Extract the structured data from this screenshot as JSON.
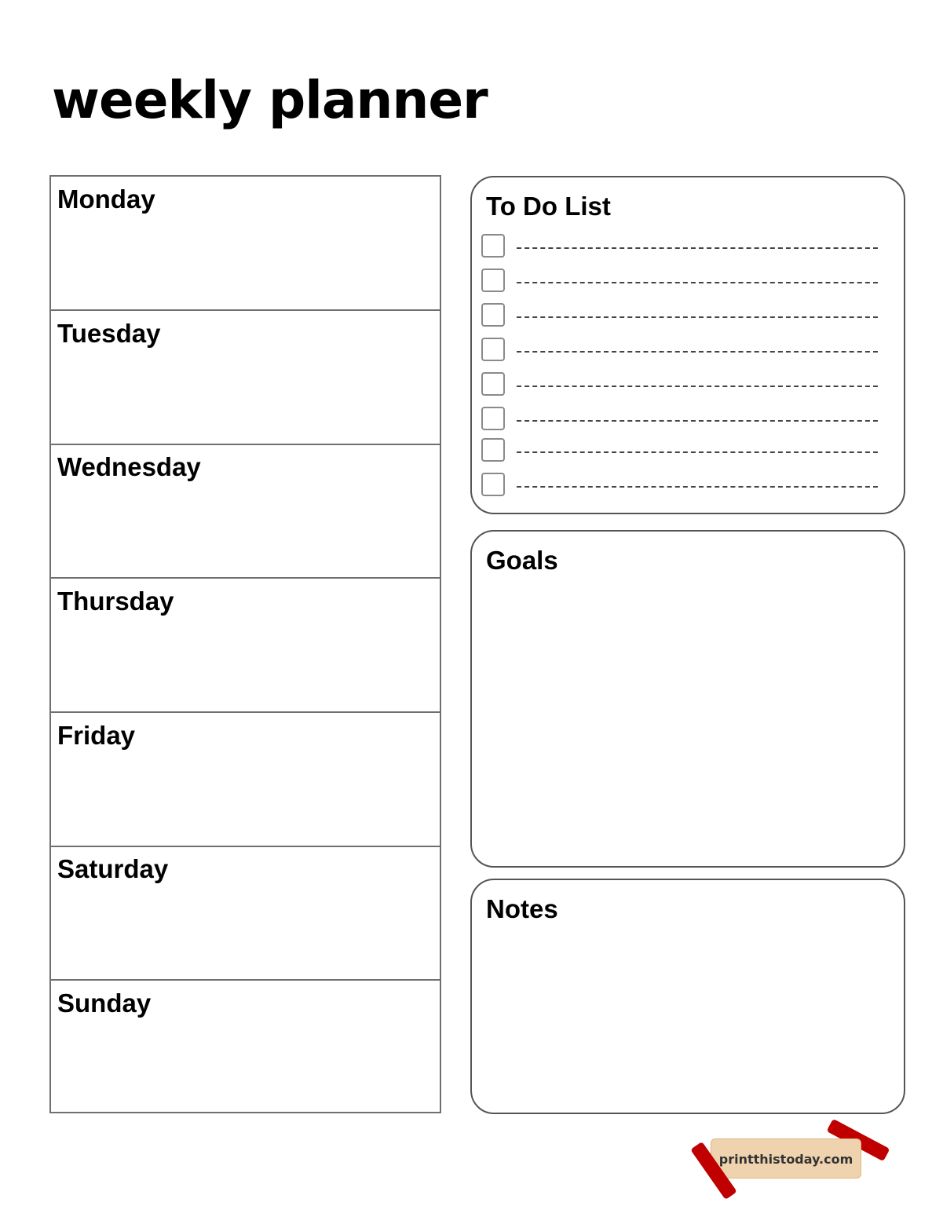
{
  "title": "Weekly Planner",
  "days": [
    {
      "label": "Monday"
    },
    {
      "label": "Tuesday"
    },
    {
      "label": "Wednesday"
    },
    {
      "label": "Thursday"
    },
    {
      "label": "Friday"
    },
    {
      "label": "Saturday"
    },
    {
      "label": "Sunday"
    }
  ],
  "todo": {
    "title": "To Do List",
    "items": [
      {
        "text": "",
        "checked": false
      },
      {
        "text": "",
        "checked": false
      },
      {
        "text": "",
        "checked": false
      },
      {
        "text": "",
        "checked": false
      },
      {
        "text": "",
        "checked": false
      },
      {
        "text": "",
        "checked": false
      },
      {
        "text": "",
        "checked": false
      },
      {
        "text": "",
        "checked": false
      }
    ]
  },
  "goals": {
    "title": "Goals"
  },
  "notes": {
    "title": "Notes"
  },
  "watermark": {
    "text": "printthistoday.com",
    "tape_color": "#c00000",
    "label_color": "#eed3ae"
  }
}
